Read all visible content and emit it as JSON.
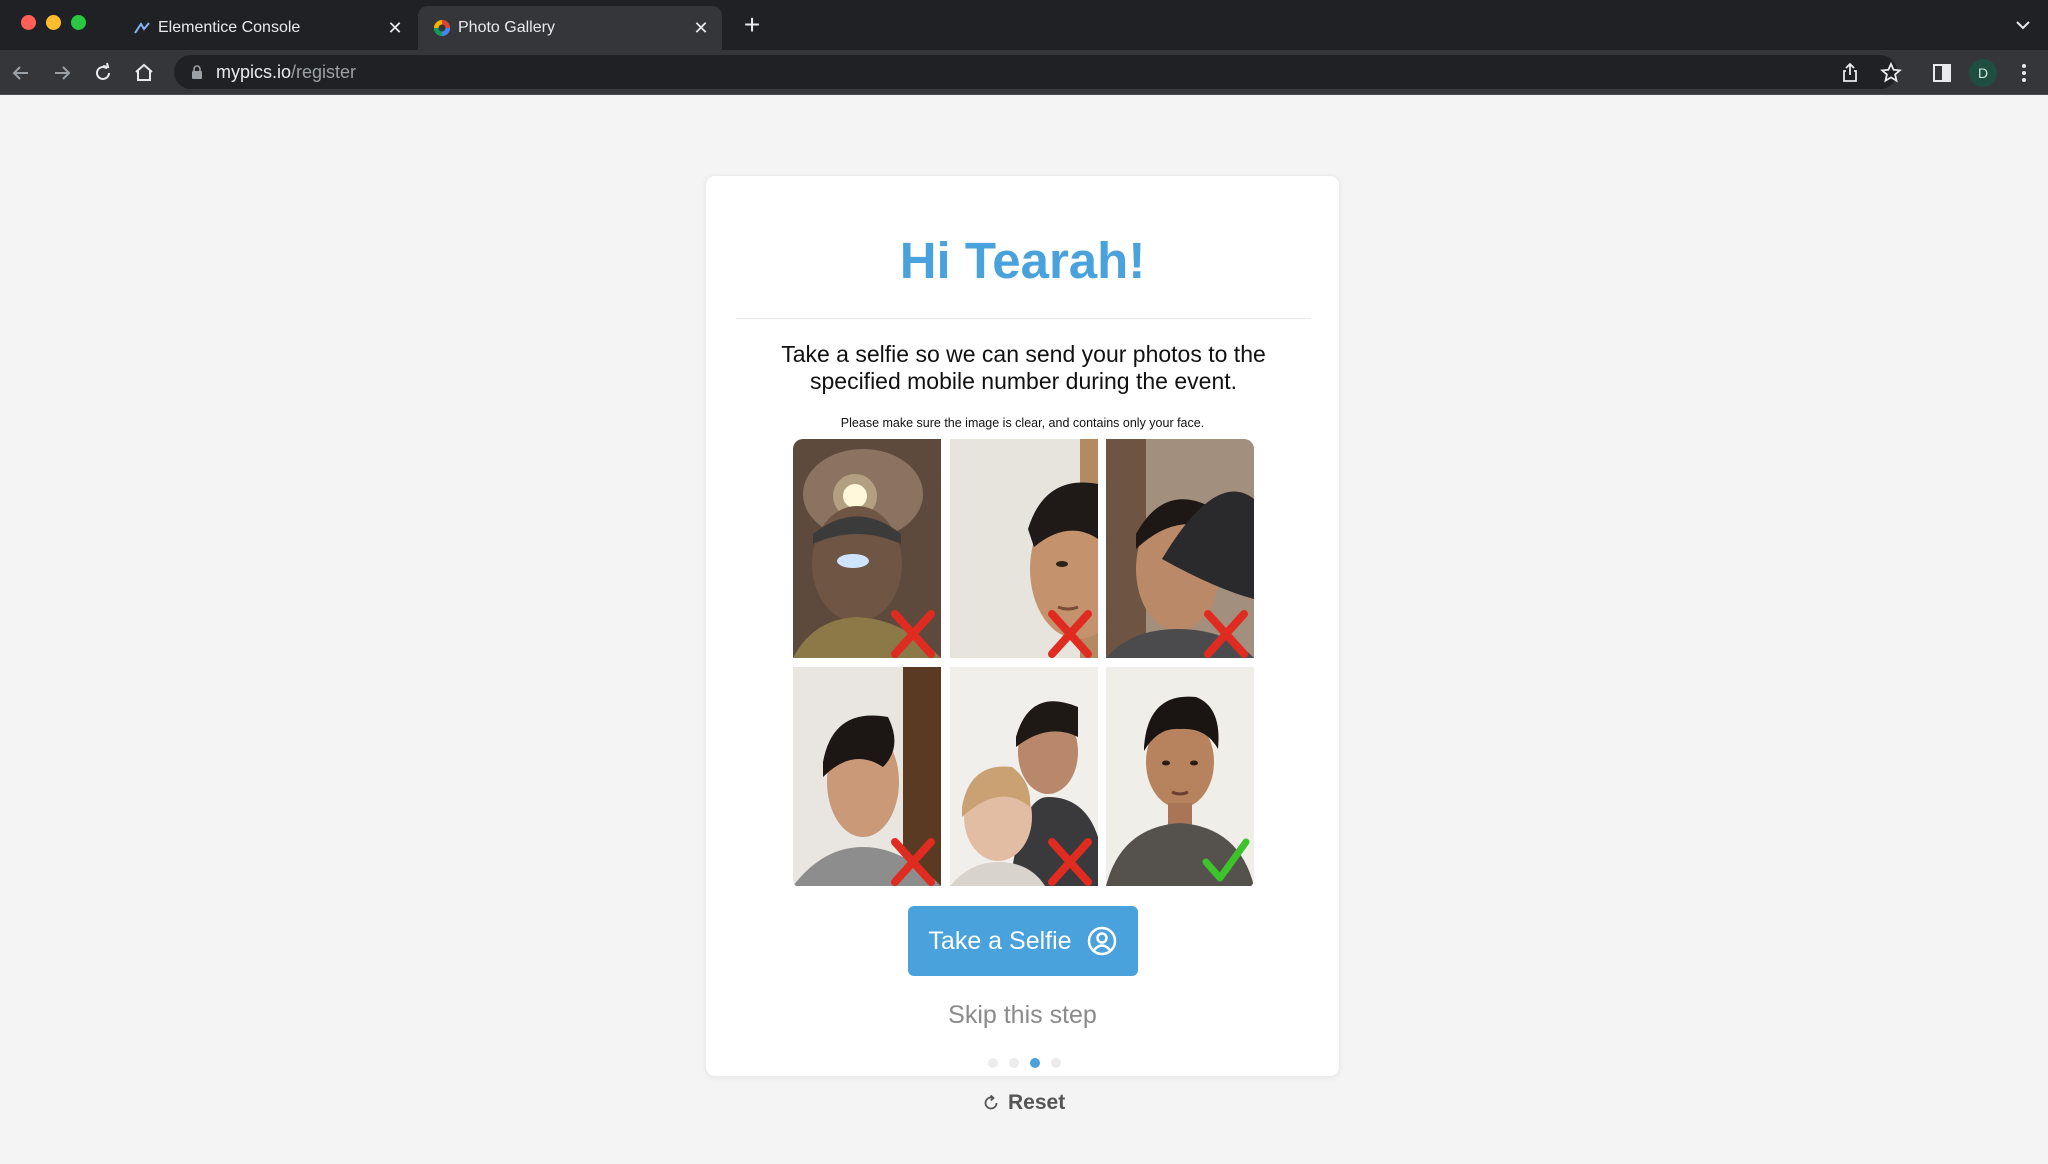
{
  "browser": {
    "tabs": [
      {
        "title": "Elementice Console",
        "active": false
      },
      {
        "title": "Photo Gallery",
        "active": true
      }
    ],
    "url_host": "mypics.io",
    "url_path": "/register",
    "profile_initial": "D",
    "icons": [
      "back-icon",
      "forward-icon",
      "reload-icon",
      "home-icon",
      "lock-icon",
      "share-icon",
      "bookmark-star-icon",
      "side-panel-icon",
      "more-icon"
    ]
  },
  "page": {
    "greeting": "Hi Tearah!",
    "intro": "Take a selfie so we can send your photos to the specified mobile number during the event.",
    "hint": "Please make sure the image is clear, and contains only your face.",
    "examples": [
      {
        "verdict": "bad",
        "icon": "red-x-icon"
      },
      {
        "verdict": "bad",
        "icon": "red-x-icon"
      },
      {
        "verdict": "bad",
        "icon": "red-x-icon"
      },
      {
        "verdict": "bad",
        "icon": "red-x-icon"
      },
      {
        "verdict": "bad",
        "icon": "red-x-icon"
      },
      {
        "verdict": "good",
        "icon": "green-check-icon"
      }
    ],
    "take_selfie_label": "Take a Selfie",
    "skip_label": "Skip this step",
    "steps_total": 4,
    "step_current": 3,
    "reset_label": "Reset"
  },
  "colors": {
    "accent": "#4aa2dc",
    "bad_mark": "#e02b20",
    "good_mark": "#3cc42a",
    "page_bg": "#f4f4f4"
  }
}
